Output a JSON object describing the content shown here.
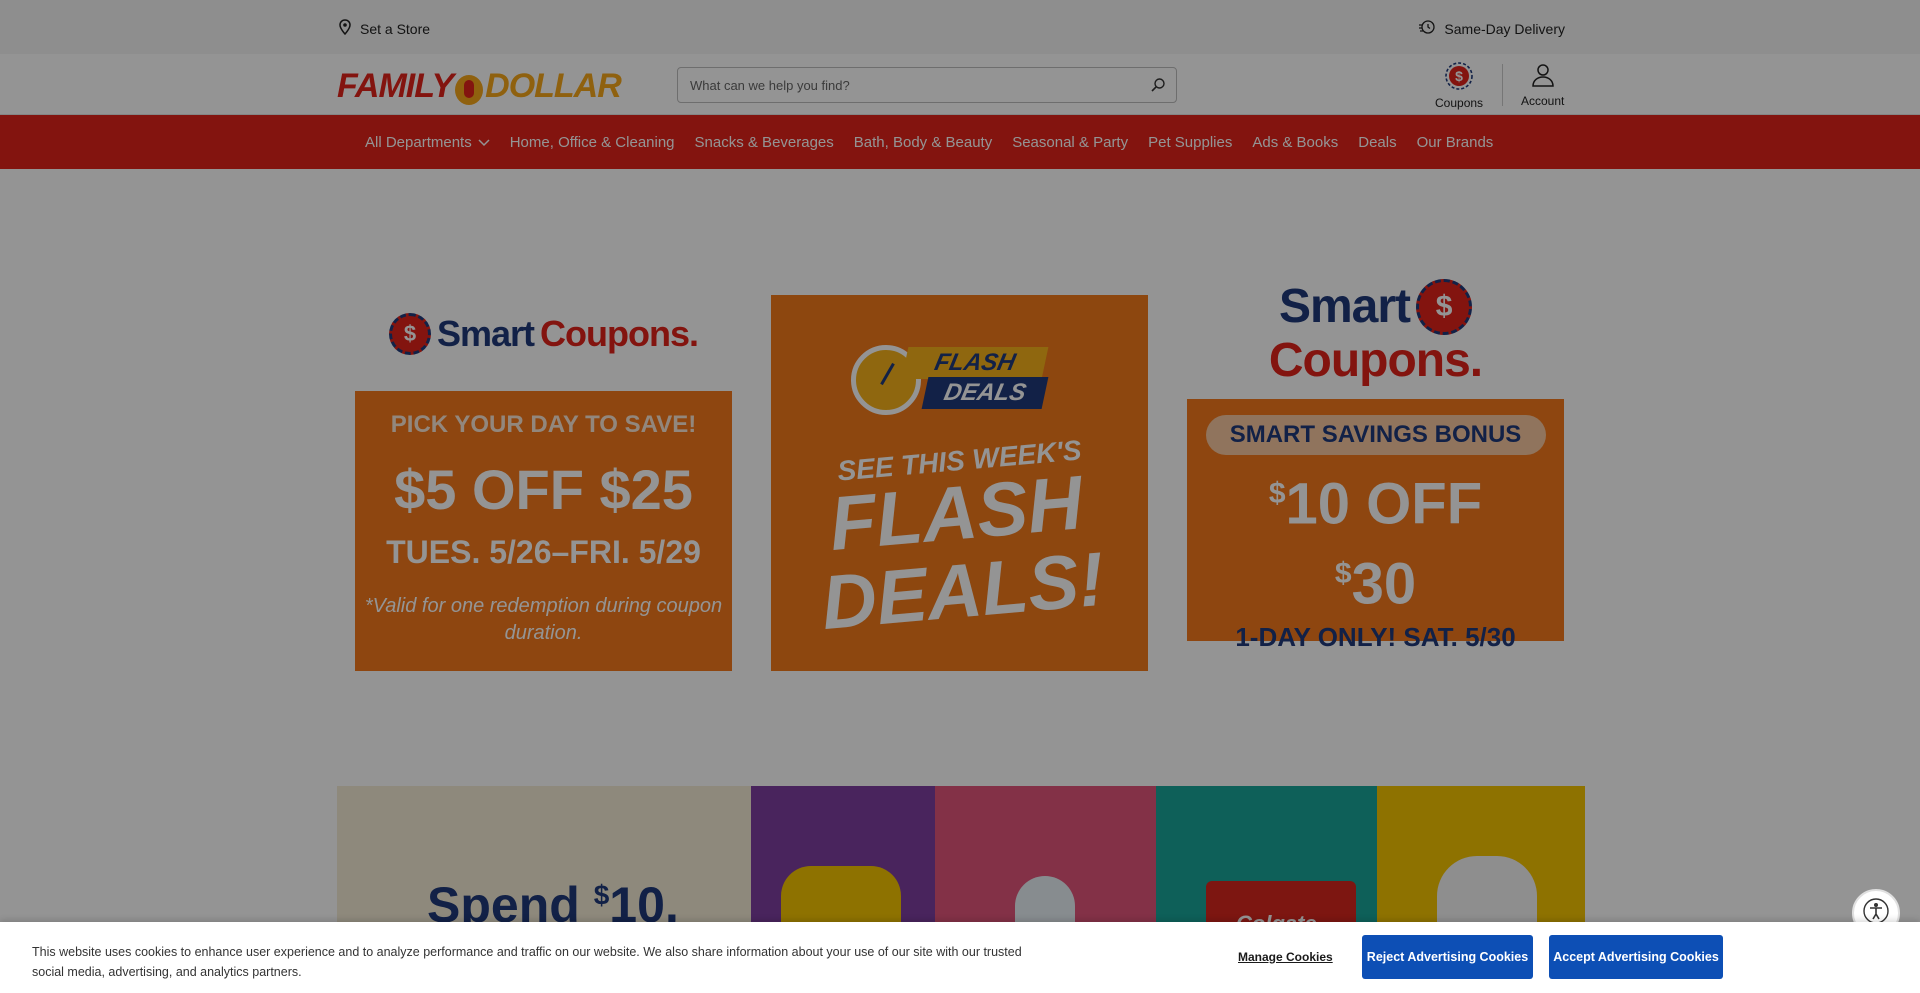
{
  "topbar": {
    "store_label": "Set a Store",
    "delivery_label": "Same-Day Delivery"
  },
  "header": {
    "logo_text_left": "FAMILY",
    "logo_text_right": "DOLLAR",
    "search_placeholder": "What can we help you find?",
    "coupons_label": "Coupons",
    "account_label": "Account"
  },
  "nav": {
    "items": [
      {
        "label": "All Departments"
      },
      {
        "label": "Home, Office & Cleaning"
      },
      {
        "label": "Snacks & Beverages"
      },
      {
        "label": "Bath, Body & Beauty"
      },
      {
        "label": "Seasonal & Party"
      },
      {
        "label": "Pet Supplies"
      },
      {
        "label": "Ads & Books"
      },
      {
        "label": "Deals"
      },
      {
        "label": "Our Brands"
      }
    ]
  },
  "hero": {
    "tile1": {
      "brand_smart": "Smart",
      "brand_coupons": "Coupons.",
      "coin": "$",
      "headline": "PICK YOUR DAY TO SAVE!",
      "offer": "$5 OFF $25",
      "dates": "TUES. 5/26–FRI. 5/29",
      "note": "*Valid for one redemption during coupon duration."
    },
    "tile2": {
      "badge_top": "FLASH",
      "badge_bottom": "DEALS",
      "line1": "SEE THIS WEEK'S",
      "line2": "FLASH DEALS!"
    },
    "tile3": {
      "brand_smart": "Smart",
      "brand_coupons": "Coupons.",
      "coin": "$",
      "pill": "SMART SAVINGS BONUS",
      "offer_line1": "10 OFF",
      "offer_line2": "30",
      "currency": "$",
      "day": "1-DAY ONLY! SAT. 5/30"
    }
  },
  "promo": {
    "spend_text": "Spend",
    "spend_currency": "$",
    "spend_amount": "10,",
    "product_brand": "Colgate"
  },
  "cookie": {
    "message": "This website uses cookies to enhance user experience and to analyze performance and traffic on our website. We also share information about your use of our site with our trusted social media, advertising, and analytics partners.",
    "manage_label": "Manage Cookies",
    "reject_label": "Reject Advertising Cookies",
    "accept_label": "Accept Advertising Cookies"
  },
  "colors": {
    "brand_red": "#e2231a",
    "brand_orange": "#f4791c",
    "brand_navy": "#1f3a7a",
    "button_blue": "#0d4fb5"
  }
}
